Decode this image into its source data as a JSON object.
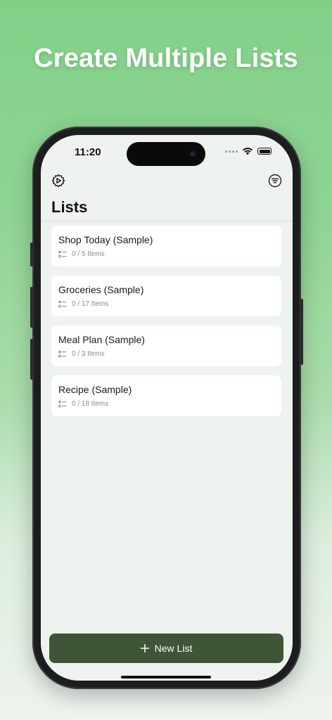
{
  "headline": "Create Multiple Lists",
  "status_bar": {
    "time": "11:20",
    "icons": [
      "signal-dots-icon",
      "wifi-icon",
      "battery-icon"
    ]
  },
  "toolbar": {
    "left_icon": "settings-gear-icon",
    "right_icon": "filter-icon"
  },
  "page_title": "Lists",
  "lists": [
    {
      "name": "Shop Today (Sample)",
      "count": "0 / 5 Items"
    },
    {
      "name": "Groceries (Sample)",
      "count": "0 / 17 Items"
    },
    {
      "name": "Meal Plan (Sample)",
      "count": "0 / 3 Items"
    },
    {
      "name": "Recipe (Sample)",
      "count": "0 / 18 Items"
    }
  ],
  "new_list_button": {
    "label": "New List",
    "icon": "plus-icon"
  },
  "colors": {
    "background_top": "#82d088",
    "screen_background": "#eff3ef",
    "card_background": "#ffffff",
    "button_background": "#3f5537",
    "button_text": "#ffffff"
  }
}
